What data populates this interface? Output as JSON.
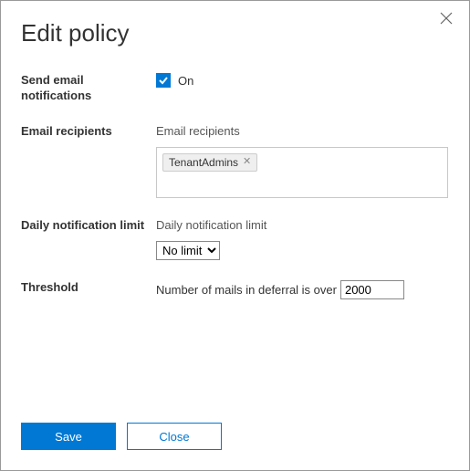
{
  "title": "Edit policy",
  "sendEmail": {
    "label": "Send email notifications",
    "checked": true,
    "onLabel": "On"
  },
  "recipients": {
    "label": "Email recipients",
    "sublabel": "Email recipients",
    "tags": [
      "TenantAdmins"
    ]
  },
  "dailyLimit": {
    "label": "Daily notification limit",
    "sublabel": "Daily notification limit",
    "selected": "No limit"
  },
  "threshold": {
    "label": "Threshold",
    "text": "Number of mails in deferral is over",
    "value": "2000"
  },
  "buttons": {
    "save": "Save",
    "close": "Close"
  }
}
